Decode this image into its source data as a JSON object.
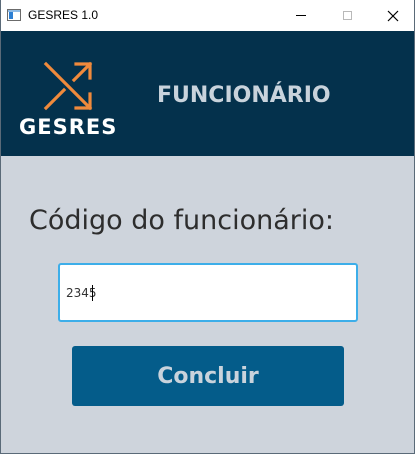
{
  "window": {
    "title": "GESRES 1.0",
    "controls": [
      "minimize",
      "maximize",
      "close"
    ]
  },
  "header": {
    "logo_text": "GESRES",
    "title": "FUNCIONÁRIO",
    "logo_icon": "shuffle-arrows-icon"
  },
  "form": {
    "label": "Código do funcionário:",
    "code_value": "2345",
    "submit_label": "Concluir"
  },
  "colors": {
    "header_bg": "#04314c",
    "body_bg": "#ced4dc",
    "accent_orange": "#f08a3c",
    "button_bg": "#045c8a",
    "input_focus_border": "#3daee9"
  }
}
